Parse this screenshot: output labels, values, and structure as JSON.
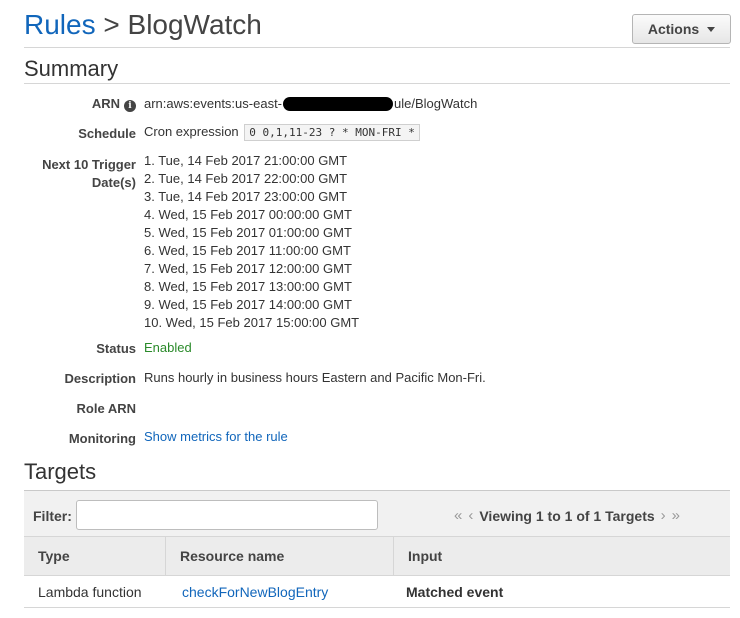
{
  "header": {
    "breadcrumb_parent": "Rules",
    "separator": ">",
    "page_title": "BlogWatch",
    "actions_label": "Actions"
  },
  "summary": {
    "section_title": "Summary",
    "arn_label": "ARN",
    "arn_prefix": "arn:aws:events:us-east-",
    "arn_suffix": "ule/BlogWatch",
    "schedule_label": "Schedule",
    "schedule_type": "Cron expression",
    "cron_expression": "0 0,1,11-23 ? * MON-FRI *",
    "trigger_label_line1": "Next 10 Trigger",
    "trigger_label_line2": "Date(s)",
    "trigger_dates": [
      "1. Tue, 14 Feb 2017 21:00:00 GMT",
      "2. Tue, 14 Feb 2017 22:00:00 GMT",
      "3. Tue, 14 Feb 2017 23:00:00 GMT",
      "4. Wed, 15 Feb 2017 00:00:00 GMT",
      "5. Wed, 15 Feb 2017 01:00:00 GMT",
      "6. Wed, 15 Feb 2017 11:00:00 GMT",
      "7. Wed, 15 Feb 2017 12:00:00 GMT",
      "8. Wed, 15 Feb 2017 13:00:00 GMT",
      "9. Wed, 15 Feb 2017 14:00:00 GMT",
      "10. Wed, 15 Feb 2017 15:00:00 GMT"
    ],
    "status_label": "Status",
    "status_value": "Enabled",
    "description_label": "Description",
    "description_value": "Runs hourly in business hours Eastern and Pacific Mon-Fri.",
    "role_arn_label": "Role ARN",
    "role_arn_value": "",
    "monitoring_label": "Monitoring",
    "monitoring_link": "Show metrics for the rule"
  },
  "targets": {
    "section_title": "Targets",
    "filter_label": "Filter:",
    "filter_value": "",
    "pager_text": "Viewing 1 to 1 of 1 Targets",
    "columns": [
      "Type",
      "Resource name",
      "Input"
    ],
    "rows": [
      {
        "type": "Lambda function",
        "resource_name": "checkForNewBlogEntry",
        "input": "Matched event"
      }
    ]
  },
  "colors": {
    "link": "#1166bb",
    "status_enabled": "#2a8a2a"
  }
}
